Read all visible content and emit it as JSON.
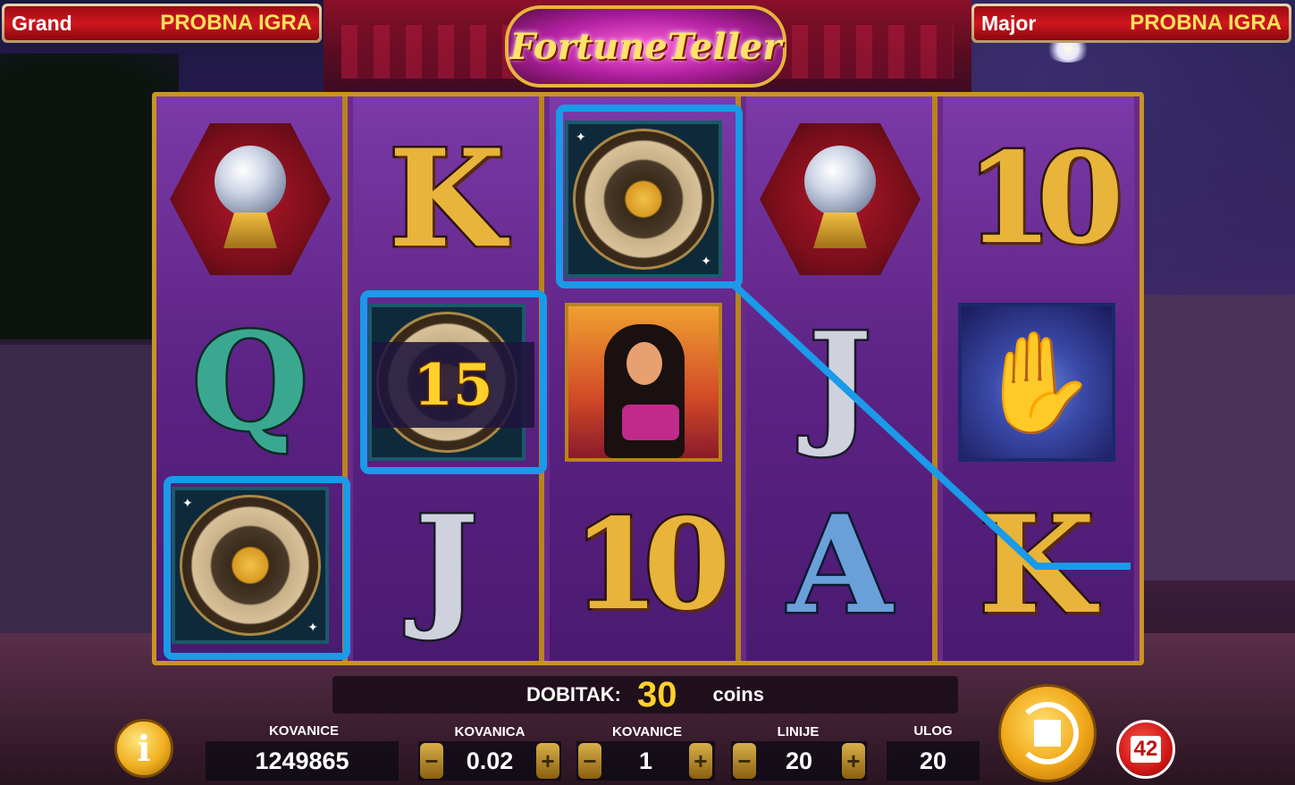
{
  "jackpots": [
    {
      "name": "Grand",
      "value": "PROBNA IGRA"
    },
    {
      "name": "Major",
      "value": "PROBNA IGRA"
    }
  ],
  "logo_text": "FortuneTeller",
  "reels": [
    [
      "crystal-ball",
      "Q",
      "sun-wheel"
    ],
    [
      "K",
      "sun-wheel",
      "J"
    ],
    [
      "sun-wheel",
      "dancer",
      "10"
    ],
    [
      "crystal-ball",
      "J",
      "A"
    ],
    [
      "10",
      "palm",
      "K"
    ]
  ],
  "win_multiplier_label": "15",
  "win": {
    "label": "DOBITAK:",
    "value": "30",
    "unit": "coins"
  },
  "controls": {
    "info_icon": "i",
    "coins_total": {
      "label": "KOVANICE",
      "value": "1249865"
    },
    "coin_value": {
      "label": "KOVANICA",
      "value": "0.02"
    },
    "coins_per_line": {
      "label": "KOVANICE",
      "value": "1"
    },
    "lines": {
      "label": "LINIJE",
      "value": "20"
    },
    "bet": {
      "label": "ULOG",
      "value": "20"
    },
    "minus": "−",
    "plus": "+",
    "autoplay_count": "42"
  },
  "colors": {
    "highlight": "#1a9ae8",
    "accent_gold": "#ffd12a",
    "jackpot_red": "#d0161f"
  }
}
